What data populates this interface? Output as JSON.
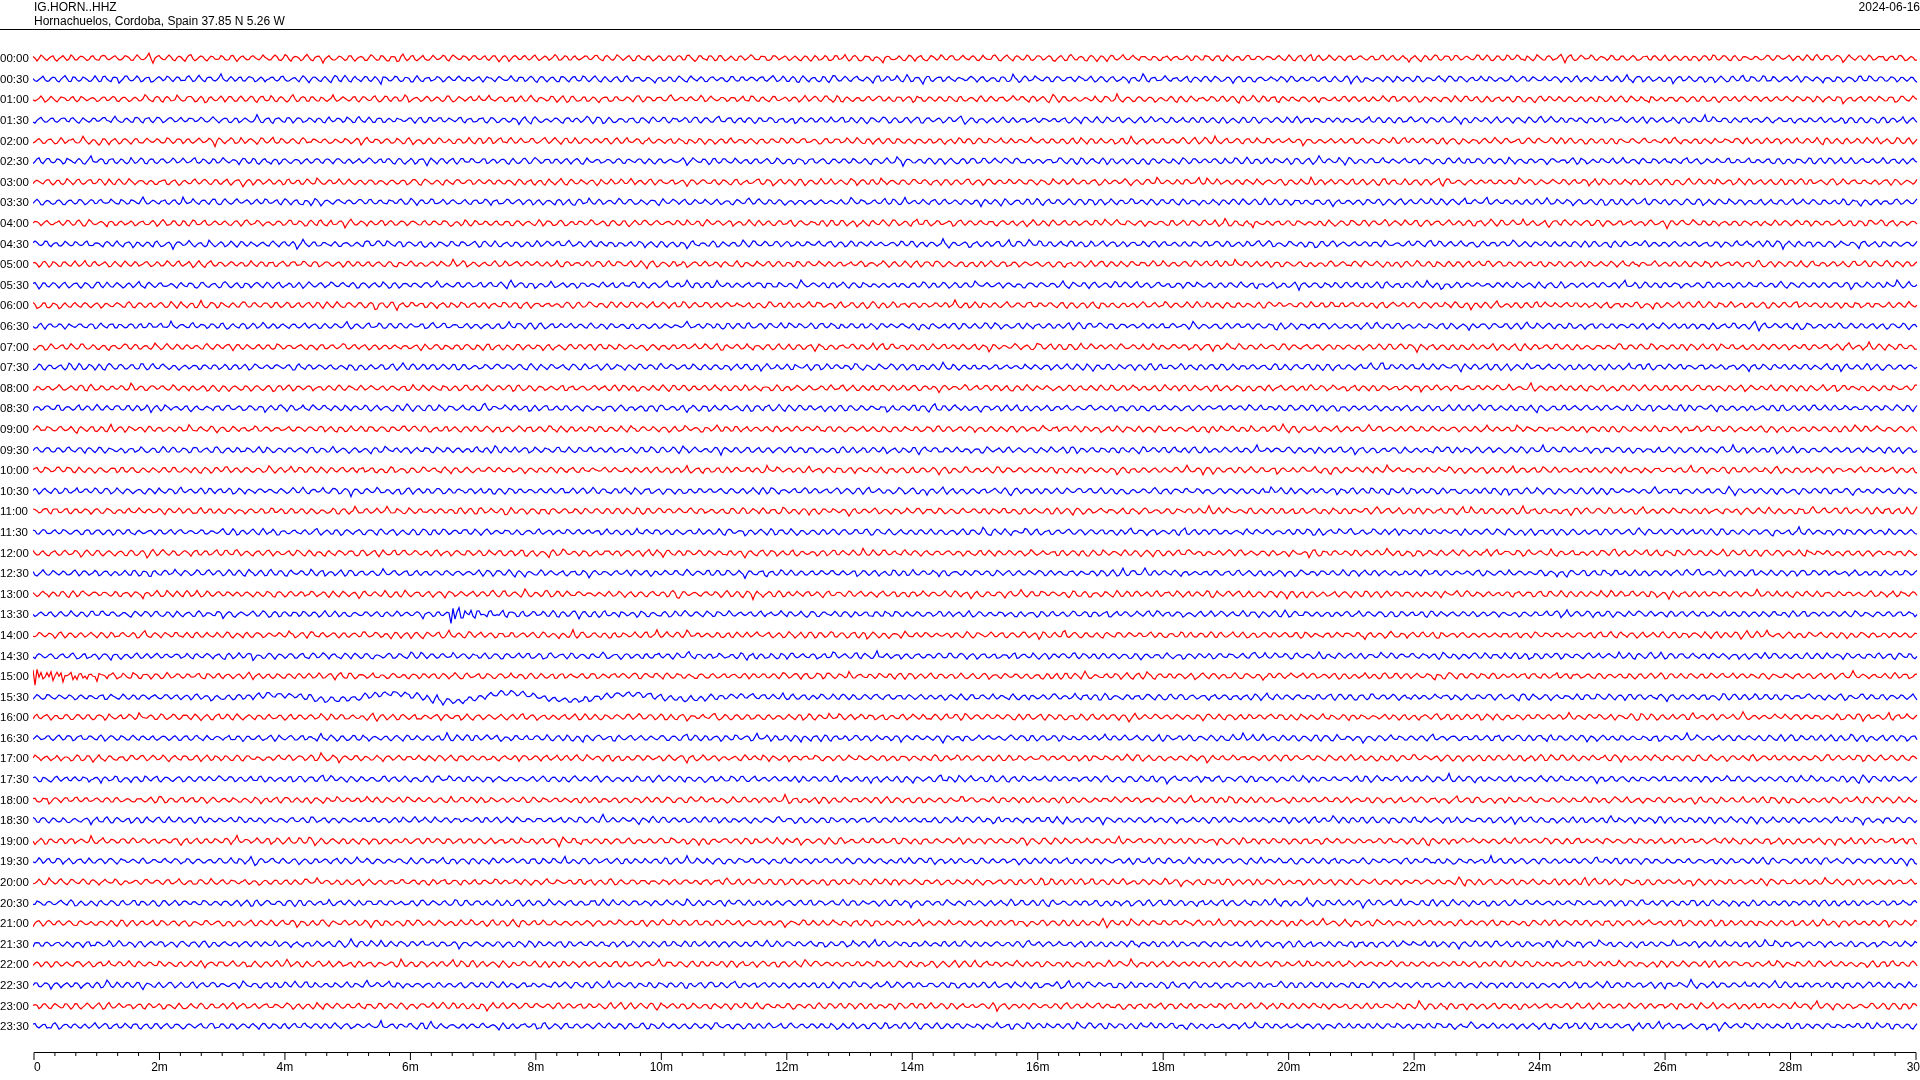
{
  "header": {
    "channel": "IG.HORN..HHZ",
    "location": "Hornachuelos, Cordoba, Spain  37.85 N 5.26 W",
    "date": "2024-06-16"
  },
  "rows": [
    {
      "time": "00:00",
      "color": "#ff0000"
    },
    {
      "time": "00:30",
      "color": "#0000ff"
    },
    {
      "time": "01:00",
      "color": "#ff0000"
    },
    {
      "time": "01:30",
      "color": "#0000ff"
    },
    {
      "time": "02:00",
      "color": "#ff0000"
    },
    {
      "time": "02:30",
      "color": "#0000ff"
    },
    {
      "time": "03:00",
      "color": "#ff0000"
    },
    {
      "time": "03:30",
      "color": "#0000ff"
    },
    {
      "time": "04:00",
      "color": "#ff0000"
    },
    {
      "time": "04:30",
      "color": "#0000ff"
    },
    {
      "time": "05:00",
      "color": "#ff0000"
    },
    {
      "time": "05:30",
      "color": "#0000ff"
    },
    {
      "time": "06:00",
      "color": "#ff0000"
    },
    {
      "time": "06:30",
      "color": "#0000ff"
    },
    {
      "time": "07:00",
      "color": "#ff0000"
    },
    {
      "time": "07:30",
      "color": "#0000ff"
    },
    {
      "time": "08:00",
      "color": "#ff0000"
    },
    {
      "time": "08:30",
      "color": "#0000ff"
    },
    {
      "time": "09:00",
      "color": "#ff0000"
    },
    {
      "time": "09:30",
      "color": "#0000ff"
    },
    {
      "time": "10:00",
      "color": "#ff0000"
    },
    {
      "time": "10:30",
      "color": "#0000ff"
    },
    {
      "time": "11:00",
      "color": "#ff0000"
    },
    {
      "time": "11:30",
      "color": "#0000ff"
    },
    {
      "time": "12:00",
      "color": "#ff0000"
    },
    {
      "time": "12:30",
      "color": "#0000ff"
    },
    {
      "time": "13:00",
      "color": "#ff0000"
    },
    {
      "time": "13:30",
      "color": "#0000ff"
    },
    {
      "time": "14:00",
      "color": "#ff0000"
    },
    {
      "time": "14:30",
      "color": "#0000ff"
    },
    {
      "time": "15:00",
      "color": "#ff0000"
    },
    {
      "time": "15:30",
      "color": "#0000ff"
    },
    {
      "time": "16:00",
      "color": "#ff0000"
    },
    {
      "time": "16:30",
      "color": "#0000ff"
    },
    {
      "time": "17:00",
      "color": "#ff0000"
    },
    {
      "time": "17:30",
      "color": "#0000ff"
    },
    {
      "time": "18:00",
      "color": "#ff0000"
    },
    {
      "time": "18:30",
      "color": "#0000ff"
    },
    {
      "time": "19:00",
      "color": "#ff0000"
    },
    {
      "time": "19:30",
      "color": "#0000ff"
    },
    {
      "time": "20:00",
      "color": "#ff0000"
    },
    {
      "time": "20:30",
      "color": "#0000ff"
    },
    {
      "time": "21:00",
      "color": "#ff0000"
    },
    {
      "time": "21:30",
      "color": "#0000ff"
    },
    {
      "time": "22:00",
      "color": "#ff0000"
    },
    {
      "time": "22:30",
      "color": "#0000ff"
    },
    {
      "time": "23:00",
      "color": "#ff0000"
    },
    {
      "time": "23:30",
      "color": "#0000ff"
    }
  ],
  "axis": {
    "ticks": [
      "0",
      "2m",
      "4m",
      "6m",
      "8m",
      "10m",
      "12m",
      "14m",
      "16m",
      "18m",
      "20m",
      "22m",
      "24m",
      "26m",
      "28m",
      "30"
    ]
  }
}
